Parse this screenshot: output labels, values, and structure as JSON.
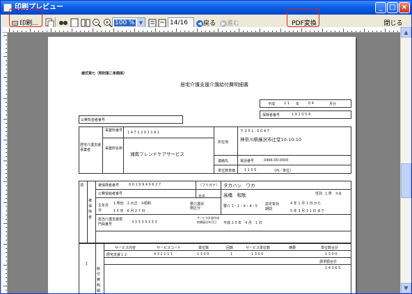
{
  "window": {
    "title": "印刷プレビュー"
  },
  "toolbar": {
    "print_label": "印刷...",
    "zoom_value": "100 %",
    "page_value": "14/16",
    "back_label": "戻る",
    "forward_label": "進む",
    "pdf_label": "PDF変換",
    "close_label": "閉じる"
  },
  "document": {
    "form_no": "様式第七（附則第二条関係）",
    "title": "居宅介護支援介護給付費明細書",
    "year_label": "平成",
    "year": "2 1",
    "year_unit": "年",
    "month": "0 4",
    "month_unit": "月分",
    "insurer_label": "保険者番号",
    "insurer_no": "1 9 2 0 5 4",
    "public_label": "公費負担者番号",
    "office_label": "居宅介護支援事業者",
    "office_no_label": "事業所番号",
    "office_no": "1 4 7 2 2 0 1 1 9 1",
    "office_name_label": "事業所名称",
    "office_name": "湘南フレンドケアサービス",
    "addr_label": "所在地",
    "postal": "〒 2 5 1 - 0 0 4 7",
    "address": "神奈川県藤沢市辻堂10-10-10",
    "contact_label": "連絡先",
    "phone_label": "電話番号",
    "phone": "0466-00-0000",
    "unit_price_label": "単位数単価",
    "unit_price": "1 1 0 5",
    "unit_price_unit": "（円／単位）",
    "insured_label": "被保険者",
    "insured_no_label": "被保険者番号",
    "insured_no": "0 0 1 9 9 4 0 6 2 7",
    "public_recipient_label": "公費受給者番号",
    "furigana_label": "（フリガナ）",
    "furigana": "タカハシ　ワカ",
    "name_label": "氏名",
    "name": "高橋　和歌",
    "sex_label": "性別",
    "sex": "1.男　②女",
    "birth_label": "生年月日",
    "era": "1.明治　2.大正　③昭和",
    "birth_date": "1 5 年　6 月 2 7 日",
    "care_label": "要介護状態区分",
    "care_level": "要介 1・2・③・4・5",
    "cert_label": "認定有効期間",
    "cert_from": "4 年 1 月 1 日 から",
    "cert_to": "5 年 3 月 3 1 日 まで",
    "manager_label": "担当介護支援専門員番号",
    "manager_no": "3 3 3 3 3 3 3 3",
    "plan_label": "サービス計画作成依頼届出年月日",
    "plan_date": "平成 2 0 年　4 月　1 日",
    "svc_headers": [
      "サービス内容",
      "サービスコード",
      "単位数",
      "回数",
      "サービス単位数",
      "摘要",
      "単位数合計"
    ],
    "svc_row_name": "居宅支援１２",
    "svc_code": "4 3 2 1 1 1",
    "svc_units": "1 3 0 0",
    "svc_count": "1",
    "svc_total": "1 3 0 0",
    "claim_label": "請求額合計",
    "claim_total": "1 3 0 0",
    "sum_label": "単位数合計",
    "payment_label": "給付費明細",
    "row_no": "1",
    "extra_total": "1 4 3 6 5"
  }
}
